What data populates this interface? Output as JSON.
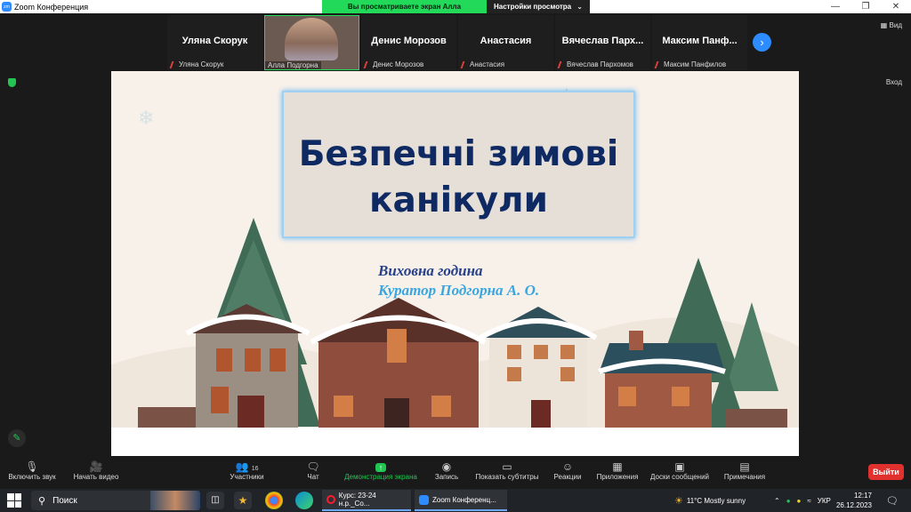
{
  "window": {
    "title": "Zoom Конференция"
  },
  "share_banner": {
    "status": "Вы просматриваете экран Алла Подгорна",
    "view_options": "Настройки просмотра"
  },
  "view_button": "Вид",
  "exit_fullscreen": "Вход",
  "participants": [
    {
      "big": "Уляна Скорук",
      "small": "Уляна Скорук",
      "muted": true
    },
    {
      "big": "",
      "small": "Алла Подгорна",
      "muted": false,
      "video": true
    },
    {
      "big": "Денис Морозов",
      "small": "Денис Морозов",
      "muted": true
    },
    {
      "big": "Анастасия",
      "small": "Анастасия",
      "muted": true
    },
    {
      "big": "Вячеслав Пархомов",
      "big_display": "Вячеслав Парх...",
      "small": "Вячеслав Пархомов",
      "muted": true
    },
    {
      "big": "Максим Панфилов",
      "big_display": "Максим Панф...",
      "small": "Максим Панфилов",
      "muted": true
    }
  ],
  "slide": {
    "title_line1": "Безпечні зимові",
    "title_line2": "канікули",
    "subtitle1": "Виховна година",
    "subtitle2": "Куратор Подгорна А. О."
  },
  "toolbar": {
    "audio": "Включить звук",
    "video": "Начать видео",
    "participants": "Участники",
    "participants_count": "16",
    "chat": "Чат",
    "share": "Демонстрация экрана",
    "record": "Запись",
    "captions": "Показать субтитры",
    "reactions": "Реакции",
    "apps": "Приложения",
    "whiteboards": "Доски сообщений",
    "notes": "Примечания",
    "leave": "Выйти"
  },
  "taskbar": {
    "search": "Поиск",
    "task1": "Курс: 23-24 н.р._Со...",
    "task2": "Zoom Конференц...",
    "weather": "11°C  Mostly sunny",
    "lang": "УКР",
    "time": "12:17",
    "date": "26.12.2023"
  },
  "colors": {
    "accent_green": "#23d959",
    "zoom_blue": "#2d8cff",
    "leave_red": "#e0312f",
    "title_navy": "#0f2a63",
    "subtitle_blue": "#39a6e0"
  }
}
